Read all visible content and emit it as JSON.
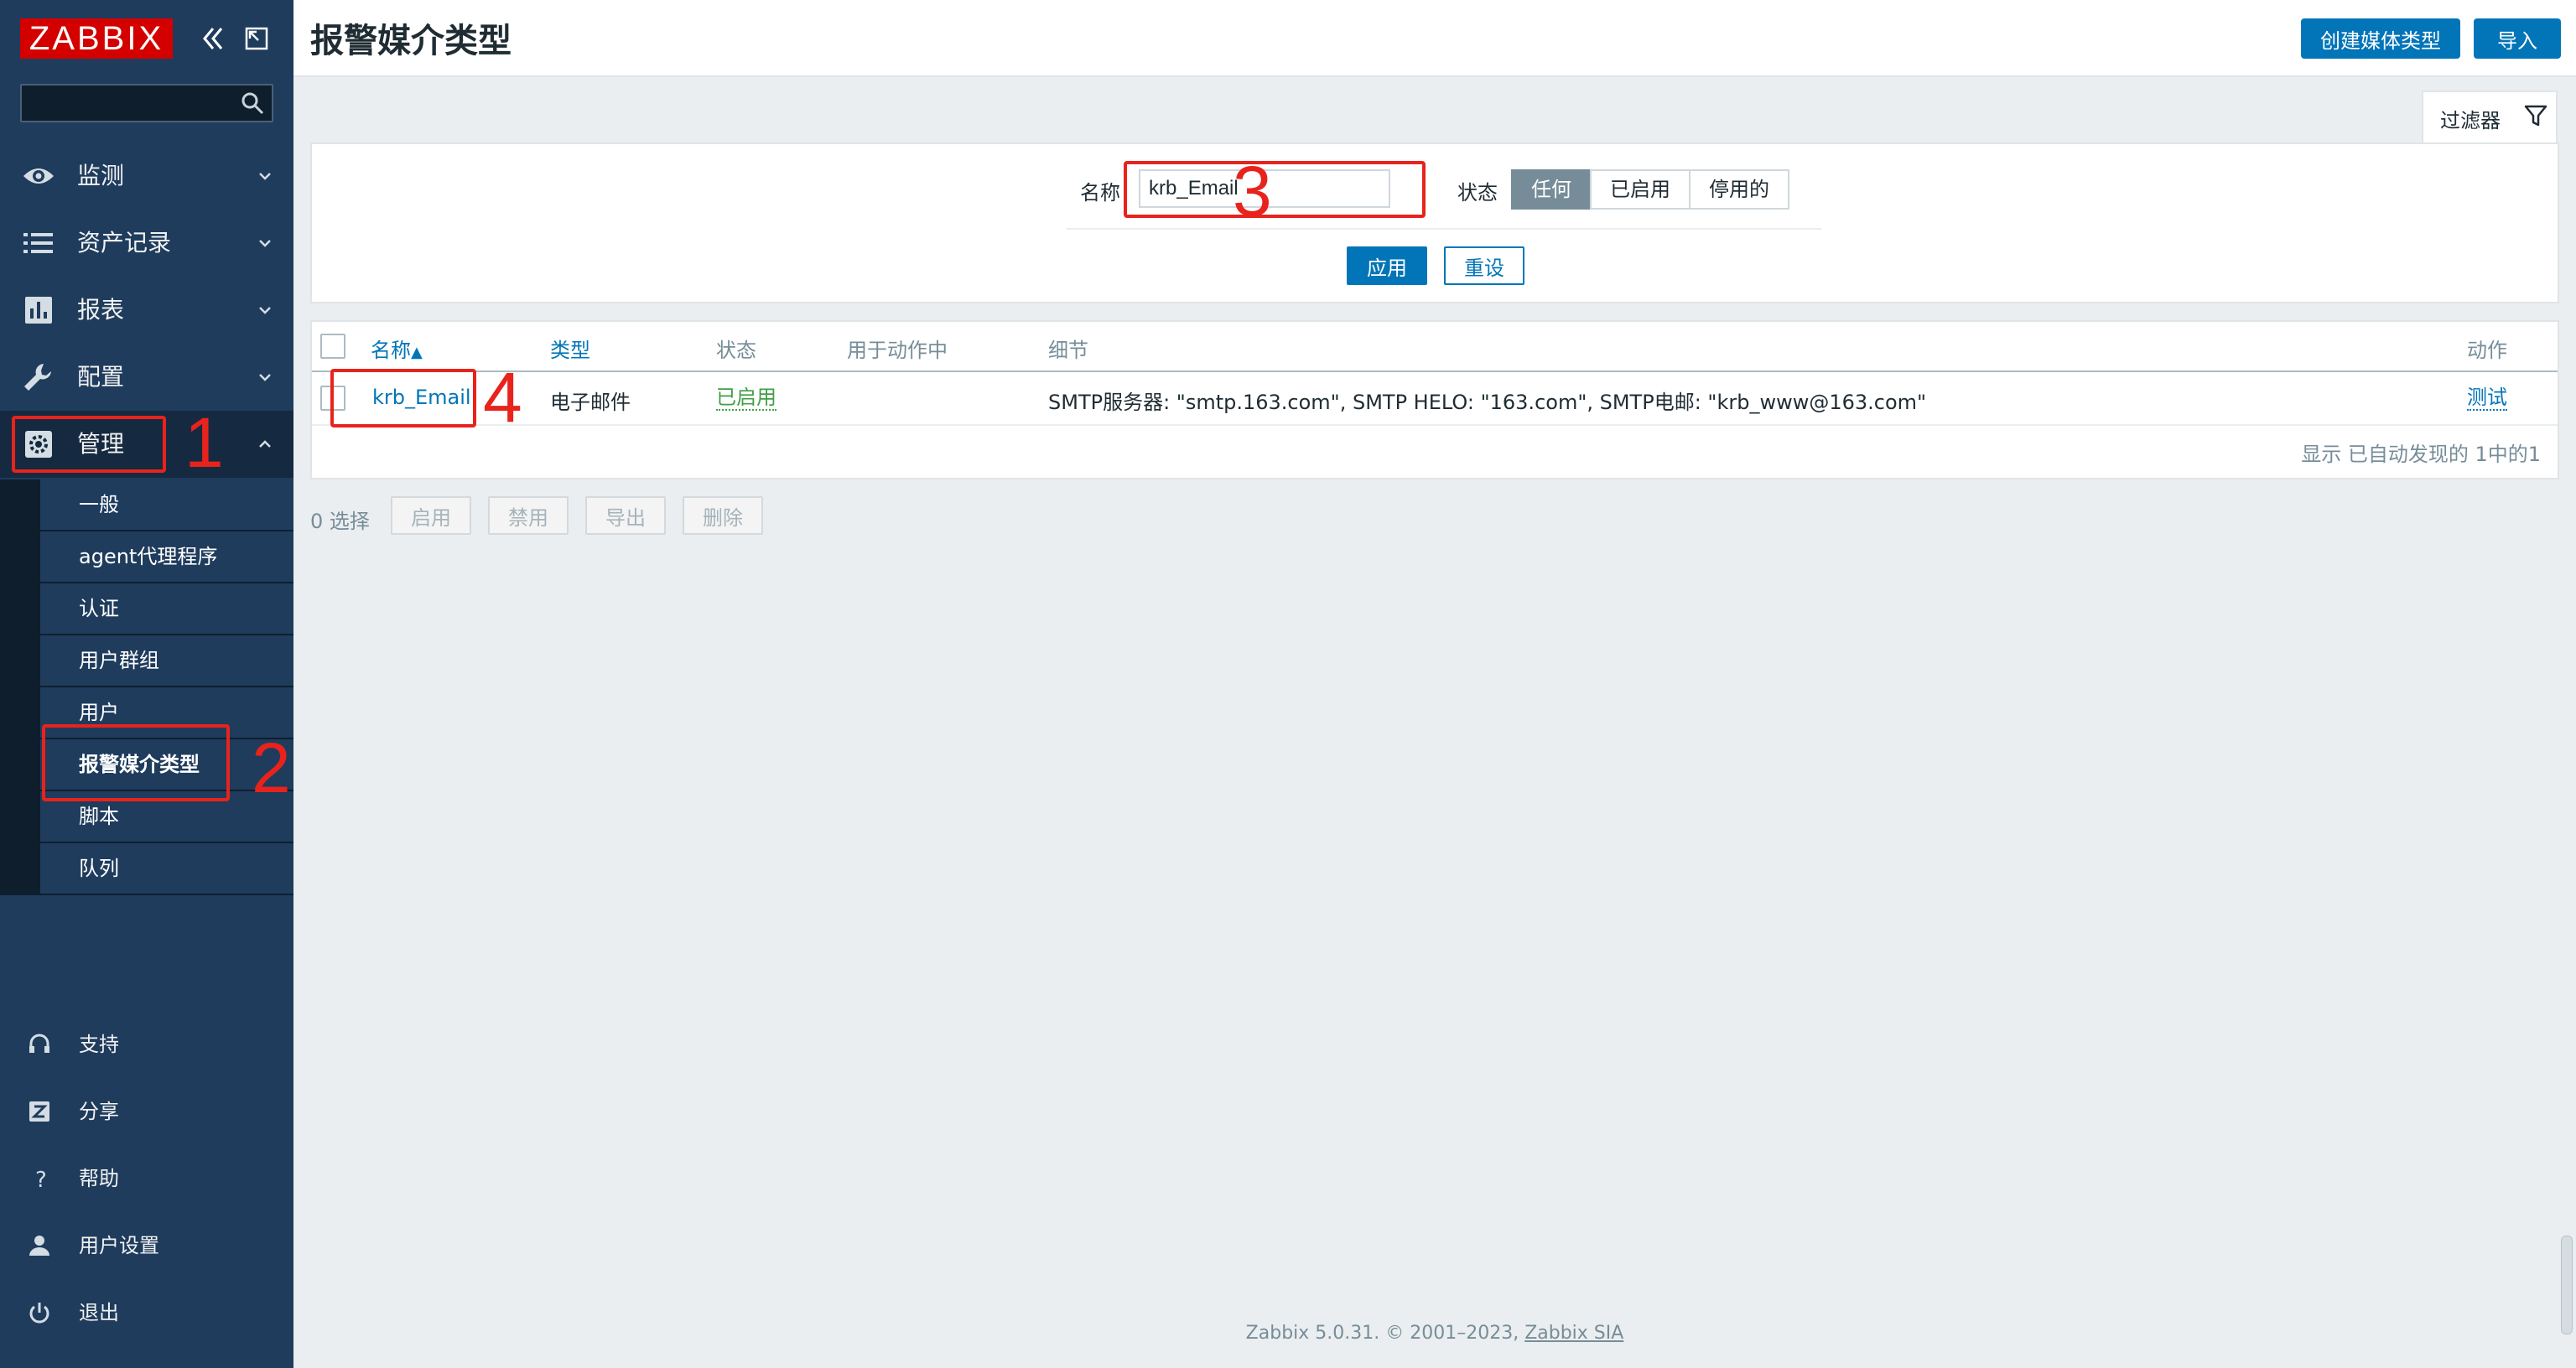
{
  "brand": {
    "logo": "ZABBIX"
  },
  "sidebar": {
    "search_placeholder": "",
    "nav": [
      {
        "id": "monitoring",
        "label": "监测",
        "icon": "eye-icon"
      },
      {
        "id": "inventory",
        "label": "资产记录",
        "icon": "list-icon"
      },
      {
        "id": "reports",
        "label": "报表",
        "icon": "bar-chart-icon"
      },
      {
        "id": "configuration",
        "label": "配置",
        "icon": "wrench-icon"
      },
      {
        "id": "administration",
        "label": "管理",
        "icon": "gear-icon"
      }
    ],
    "submenu": [
      "一般",
      "agent代理程序",
      "认证",
      "用户群组",
      "用户",
      "报警媒介类型",
      "脚本",
      "队列"
    ],
    "bottom": [
      {
        "label": "支持",
        "icon": "headset-icon"
      },
      {
        "label": "分享",
        "icon": "share-icon"
      },
      {
        "label": "帮助",
        "icon": "question-icon"
      },
      {
        "label": "用户设置",
        "icon": "user-icon"
      },
      {
        "label": "退出",
        "icon": "power-icon"
      }
    ]
  },
  "header": {
    "title": "报警媒介类型",
    "create_button": "创建媒体类型",
    "import_button": "导入"
  },
  "filter": {
    "tab_label": "过滤器",
    "name_label": "名称",
    "name_value": "krb_Email",
    "status_label": "状态",
    "status_options": [
      "任何",
      "已启用",
      "停用的"
    ],
    "status_selected": "任何",
    "apply_button": "应用",
    "reset_button": "重设"
  },
  "table": {
    "columns": {
      "name": "名称",
      "sort_indicator": "▲",
      "type": "类型",
      "status": "状态",
      "used_in_actions": "用于动作中",
      "details": "细节",
      "actions": "动作"
    },
    "rows": [
      {
        "name": "krb_Email",
        "type": "电子邮件",
        "status": "已启用",
        "used_in_actions": "",
        "details": "SMTP服务器: \"smtp.163.com\", SMTP HELO: \"163.com\", SMTP电邮: \"krb_www@163.com\"",
        "action": "测试"
      }
    ],
    "footer": "显示 已自动发现的 1中的1"
  },
  "mass_actions": {
    "selected": "0 选择",
    "buttons": [
      "启用",
      "禁用",
      "导出",
      "删除"
    ]
  },
  "footer": {
    "copyright": "Zabbix 5.0.31. © 2001–2023, ",
    "company": "Zabbix SIA"
  },
  "annotations": [
    "1",
    "2",
    "3",
    "4"
  ],
  "colors": {
    "sidebar_bg": "#1f3c5d",
    "primary_blue": "#0275b8",
    "status_enabled": "#429e47",
    "annotation_red": "#e8231c",
    "logo_red": "#d40000"
  }
}
